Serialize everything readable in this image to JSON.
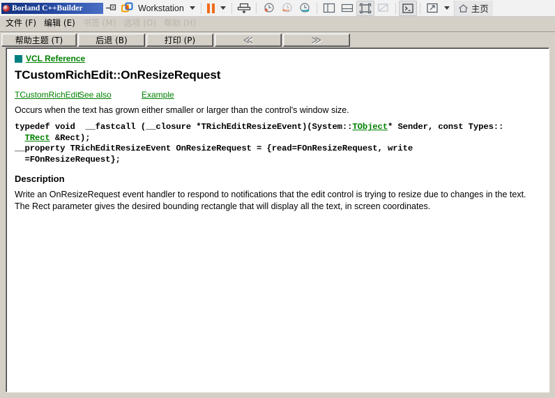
{
  "vmware": {
    "window_title": "Borland C++Builder",
    "product_label": "Workstation",
    "home_tab_label": "主页",
    "icons": {
      "pin": "pin-icon",
      "vmware_logo": "vmware-logo-icon",
      "dropdown": "chevron-down-icon",
      "pause": "pause-icon",
      "send_key": "send-ctrl-alt-del-icon",
      "snapshot_take": "take-snapshot-icon",
      "snapshot_revert": "revert-snapshot-icon",
      "snapshot_manager": "snapshot-manager-icon",
      "view_sidebar": "show-library-icon",
      "view_thumbnails": "show-thumbnails-icon",
      "view_fullscreen": "enter-fullscreen-icon",
      "view_unity": "unity-mode-icon",
      "console": "console-icon",
      "stretch": "stretch-guest-icon",
      "home": "home-icon"
    }
  },
  "help_window": {
    "menu": [
      {
        "label": "文件 (F)",
        "faded": false
      },
      {
        "label": "编辑 (E)",
        "faded": false
      },
      {
        "label": "书签 (M)",
        "faded": true
      },
      {
        "label": "选项 (O)",
        "faded": true
      },
      {
        "label": "帮助 (H)",
        "faded": true
      }
    ],
    "nav_buttons": [
      {
        "label": "帮助主题 (T)",
        "disabled": false
      },
      {
        "label": "后退 (B)",
        "disabled": false
      },
      {
        "label": "打印 (P)",
        "disabled": false
      },
      {
        "label": "≪",
        "disabled": true
      },
      {
        "label": "≫",
        "disabled": true
      }
    ]
  },
  "doc": {
    "breadcrumb": "VCL Reference",
    "title": "TCustomRichEdit::OnResizeRequest",
    "links": [
      "TCustomRichEdit",
      "See also",
      "Example"
    ],
    "intro": "Occurs when the text has grown either smaller or larger than the control's window size.",
    "code": {
      "line1_a": "typedef void  __fastcall (__closure *TRichEditResizeEvent)(System::",
      "line1_link": "TObject",
      "line1_b": "* Sender, const Types::",
      "line2_link": "TRect",
      "line2_b": " &Rect);",
      "line3": "__property TRichEditResizeEvent OnResizeRequest = {read=FOnResizeRequest, write",
      "line4": "  =FOnResizeRequest};"
    },
    "section_heading": "Description",
    "description": "Write an OnResizeRequest event handler to respond to notifications that the edit control is trying to resize due to changes in the text. The Rect parameter gives the desired bounding rectangle that will display all the text, in screen coordinates."
  },
  "colors": {
    "link_green": "#008000",
    "teal_square": "#008080",
    "titlebar_blue": "#12307e",
    "accent_orange": "#ef6c1a",
    "chrome_gray": "#d4d0c8"
  }
}
